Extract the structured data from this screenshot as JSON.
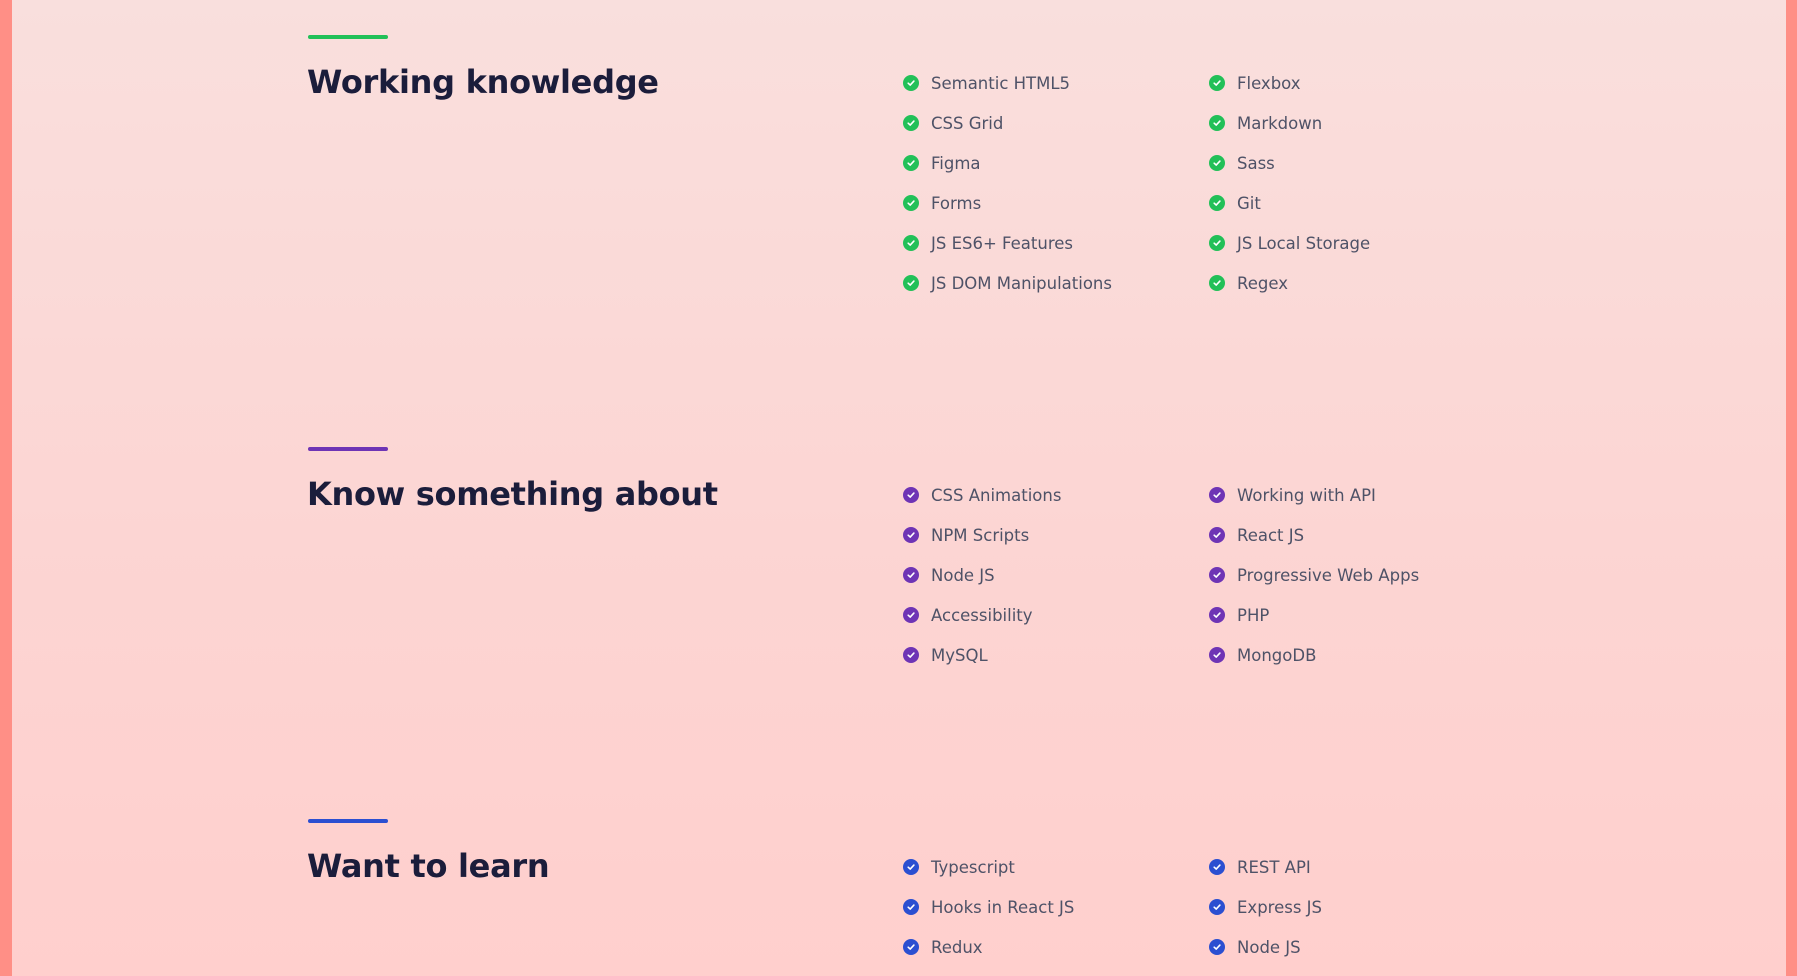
{
  "colors": {
    "green": "#22c058",
    "purple": "#6e34b5",
    "blue": "#2b4fd1",
    "title": "#1b1d3b",
    "item_text": "#4e5267",
    "edge": "#ff8f86"
  },
  "sections": [
    {
      "title": "Working knowledge",
      "accent": "green",
      "icon": "check-circle-icon",
      "left_items": [
        "Semantic HTML5",
        "CSS Grid",
        "Figma",
        "Forms",
        "JS ES6+ Features",
        "JS DOM Manipulations"
      ],
      "right_items": [
        "Flexbox",
        "Markdown",
        "Sass",
        "Git",
        "JS Local Storage",
        "Regex"
      ]
    },
    {
      "title": "Know something about",
      "accent": "purple",
      "icon": "check-circle-icon",
      "left_items": [
        "CSS Animations",
        "NPM Scripts",
        "Node JS",
        "Accessibility",
        "MySQL"
      ],
      "right_items": [
        "Working with API",
        "React JS",
        "Progressive Web Apps",
        "PHP",
        "MongoDB"
      ]
    },
    {
      "title": "Want to learn",
      "accent": "blue",
      "icon": "check-circle-icon",
      "left_items": [
        "Typescript",
        "Hooks in React JS",
        "Redux"
      ],
      "right_items": [
        "REST API",
        "Express JS",
        "Node JS"
      ]
    }
  ]
}
